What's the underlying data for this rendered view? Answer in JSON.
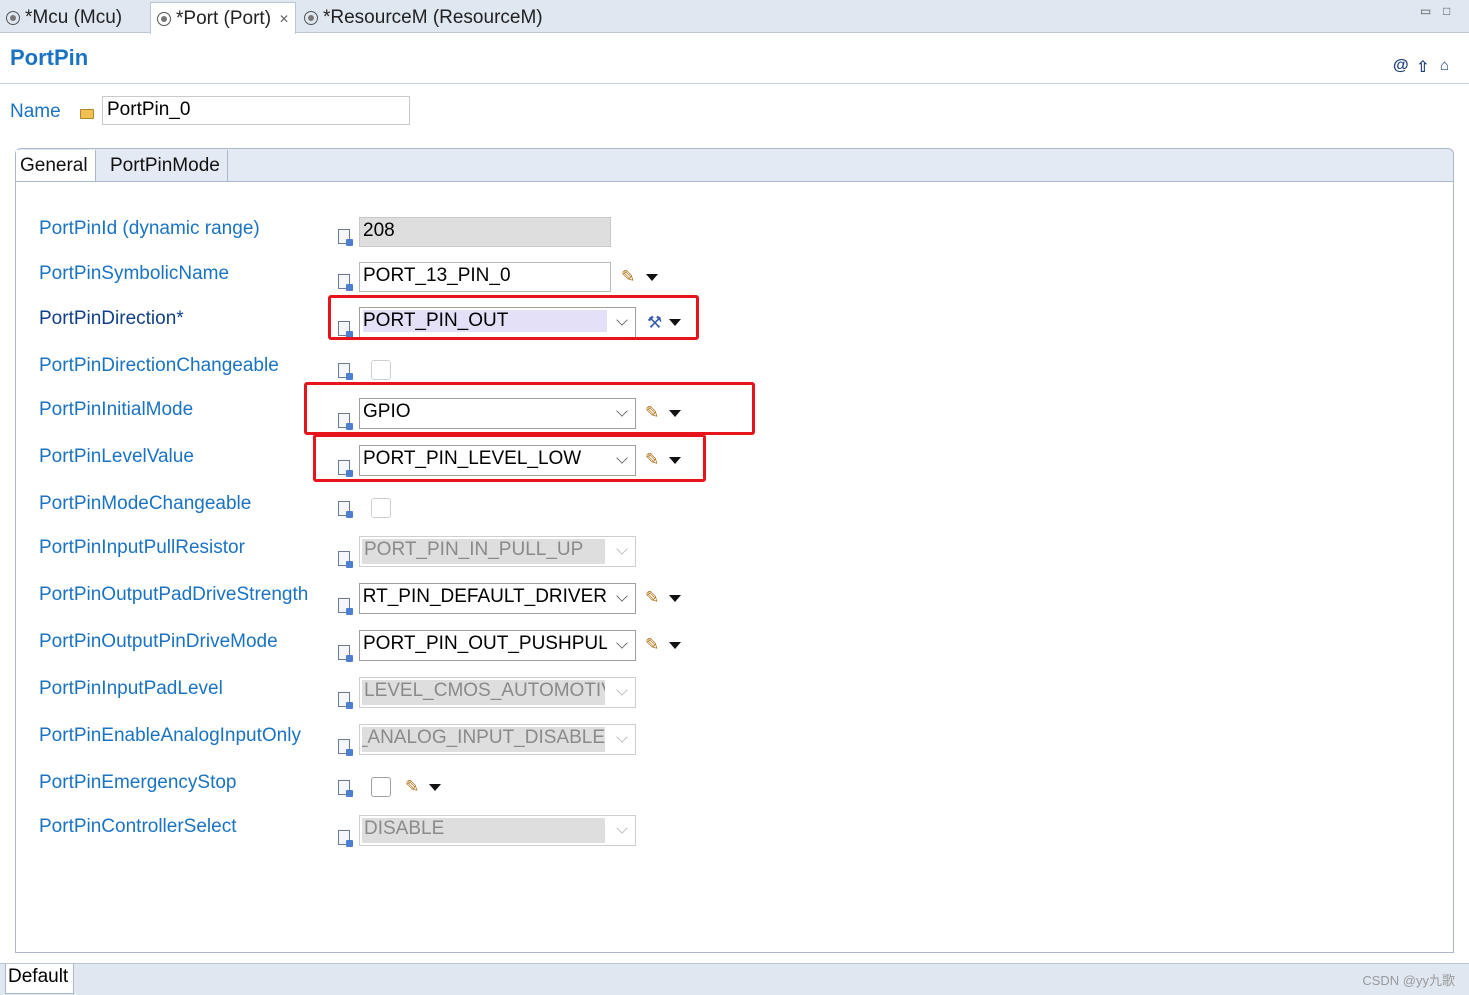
{
  "editor_tabs": [
    {
      "label": "*Mcu (Mcu)"
    },
    {
      "label": "*Port (Port)"
    },
    {
      "label": "*ResourceM (ResourceM)"
    }
  ],
  "window_controls": {
    "minimize": "▭",
    "maximize": "□"
  },
  "header": {
    "title": "PortPin"
  },
  "name_field": {
    "label": "Name",
    "value": "PortPin_0"
  },
  "panel_tabs": [
    {
      "label": "General"
    },
    {
      "label": "PortPinMode"
    }
  ],
  "rows": [
    {
      "label": "PortPinId (dynamic range)",
      "value": "208"
    },
    {
      "label": "PortPinSymbolicName",
      "value": "PORT_13_PIN_0"
    },
    {
      "label": "PortPinDirection*",
      "value": "PORT_PIN_OUT"
    },
    {
      "label": "PortPinDirectionChangeable"
    },
    {
      "label": "PortPinInitialMode",
      "value": "GPIO"
    },
    {
      "label": "PortPinLevelValue",
      "value": "PORT_PIN_LEVEL_LOW"
    },
    {
      "label": "PortPinModeChangeable"
    },
    {
      "label": "PortPinInputPullResistor",
      "value": "PORT_PIN_IN_PULL_UP"
    },
    {
      "label": "PortPinOutputPadDriveStrength",
      "value": "PORT_PIN_DEFAULT_DRIVER"
    },
    {
      "label": "PortPinOutputPinDriveMode",
      "value": "PORT_PIN_OUT_PUSHPULL"
    },
    {
      "label": "PortPinInputPadLevel",
      "value": "LEVEL_CMOS_AUTOMOTIVE"
    },
    {
      "label": "PortPinEnableAnalogInputOnly",
      "value": "N_ANALOG_INPUT_DISABLE"
    },
    {
      "label": "PortPinEmergencyStop"
    },
    {
      "label": "PortPinControllerSelect",
      "value": "DISABLE"
    }
  ],
  "bottom_tab": {
    "label": "Default"
  },
  "watermark": "CSDN @yy九歌",
  "colors": {
    "label_blue": "#1a73c2",
    "highlight_red": "#e8141c",
    "tab_bar": "#dfe7f1"
  }
}
